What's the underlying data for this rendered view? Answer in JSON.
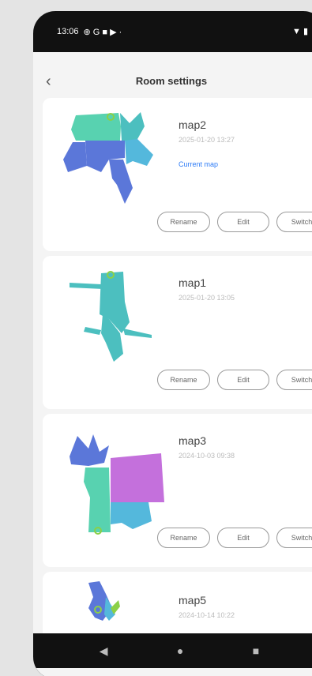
{
  "status_bar": {
    "time": "13:06",
    "indicators": "⊕ G ■ ▶ ·",
    "right_icons": "▼ ▮"
  },
  "header": {
    "title": "Room settings",
    "back_icon": "chevron-left-icon",
    "more_icon": "more-icon"
  },
  "maps": [
    {
      "name": "map2",
      "date": "2025-01-20 13:27",
      "current_label": "Current map",
      "is_current": true
    },
    {
      "name": "map1",
      "date": "2025-01-20 13:05",
      "current_label": "",
      "is_current": false
    },
    {
      "name": "map3",
      "date": "2024-10-03 09:38",
      "current_label": "",
      "is_current": false
    },
    {
      "name": "map5",
      "date": "2024-10-14 10:22",
      "current_label": "",
      "is_current": false
    }
  ],
  "buttons": {
    "rename": "Rename",
    "edit": "Edit",
    "switch": "Switch"
  },
  "nav": {
    "back": "◀",
    "home": "●",
    "recents": "■"
  },
  "colors": {
    "teal": "#4cbfbf",
    "blue": "#5b77d9",
    "cyan": "#54b8dc",
    "mint": "#58d2b0",
    "purple": "#c470dc",
    "green": "#8bd047",
    "link": "#2e7cf6"
  }
}
